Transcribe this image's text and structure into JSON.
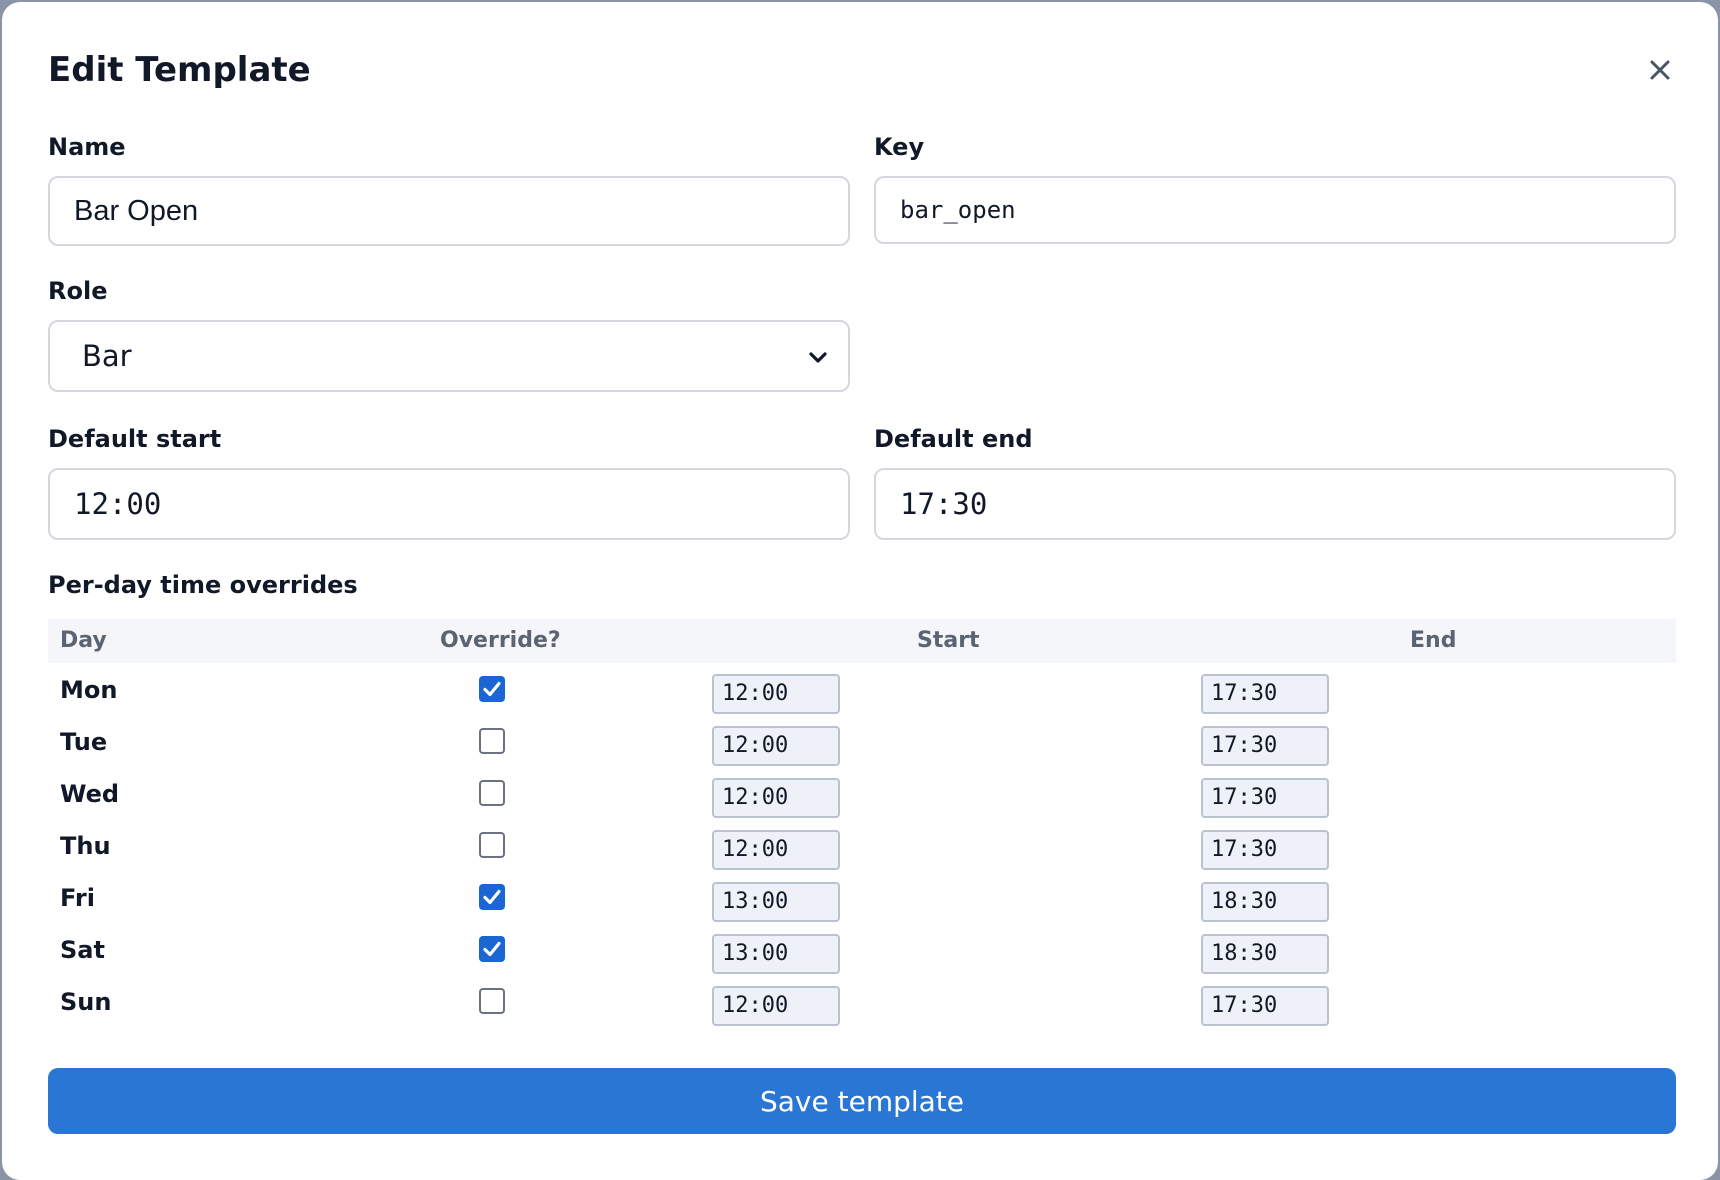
{
  "modal": {
    "title": "Edit Template",
    "close_icon": "close-icon"
  },
  "form": {
    "name_label": "Name",
    "name_value": "Bar Open",
    "key_label": "Key",
    "key_value": "bar_open",
    "role_label": "Role",
    "role_value": "Bar",
    "default_start_label": "Default start",
    "default_start_value": "12:00",
    "default_end_label": "Default end",
    "default_end_value": "17:30"
  },
  "overrides": {
    "title": "Per-day time overrides",
    "columns": [
      "Day",
      "Override?",
      "Start",
      "End"
    ],
    "rows": [
      {
        "day": "Mon",
        "override": true,
        "start": "12:00",
        "end": "17:30"
      },
      {
        "day": "Tue",
        "override": false,
        "start": "12:00",
        "end": "17:30"
      },
      {
        "day": "Wed",
        "override": false,
        "start": "12:00",
        "end": "17:30"
      },
      {
        "day": "Thu",
        "override": false,
        "start": "12:00",
        "end": "17:30"
      },
      {
        "day": "Fri",
        "override": true,
        "start": "13:00",
        "end": "18:30"
      },
      {
        "day": "Sat",
        "override": true,
        "start": "13:00",
        "end": "18:30"
      },
      {
        "day": "Sun",
        "override": false,
        "start": "12:00",
        "end": "17:30"
      }
    ]
  },
  "actions": {
    "save_label": "Save template"
  },
  "colors": {
    "accent": "#2a76d4",
    "checkbox_checked": "#1a66d2"
  }
}
